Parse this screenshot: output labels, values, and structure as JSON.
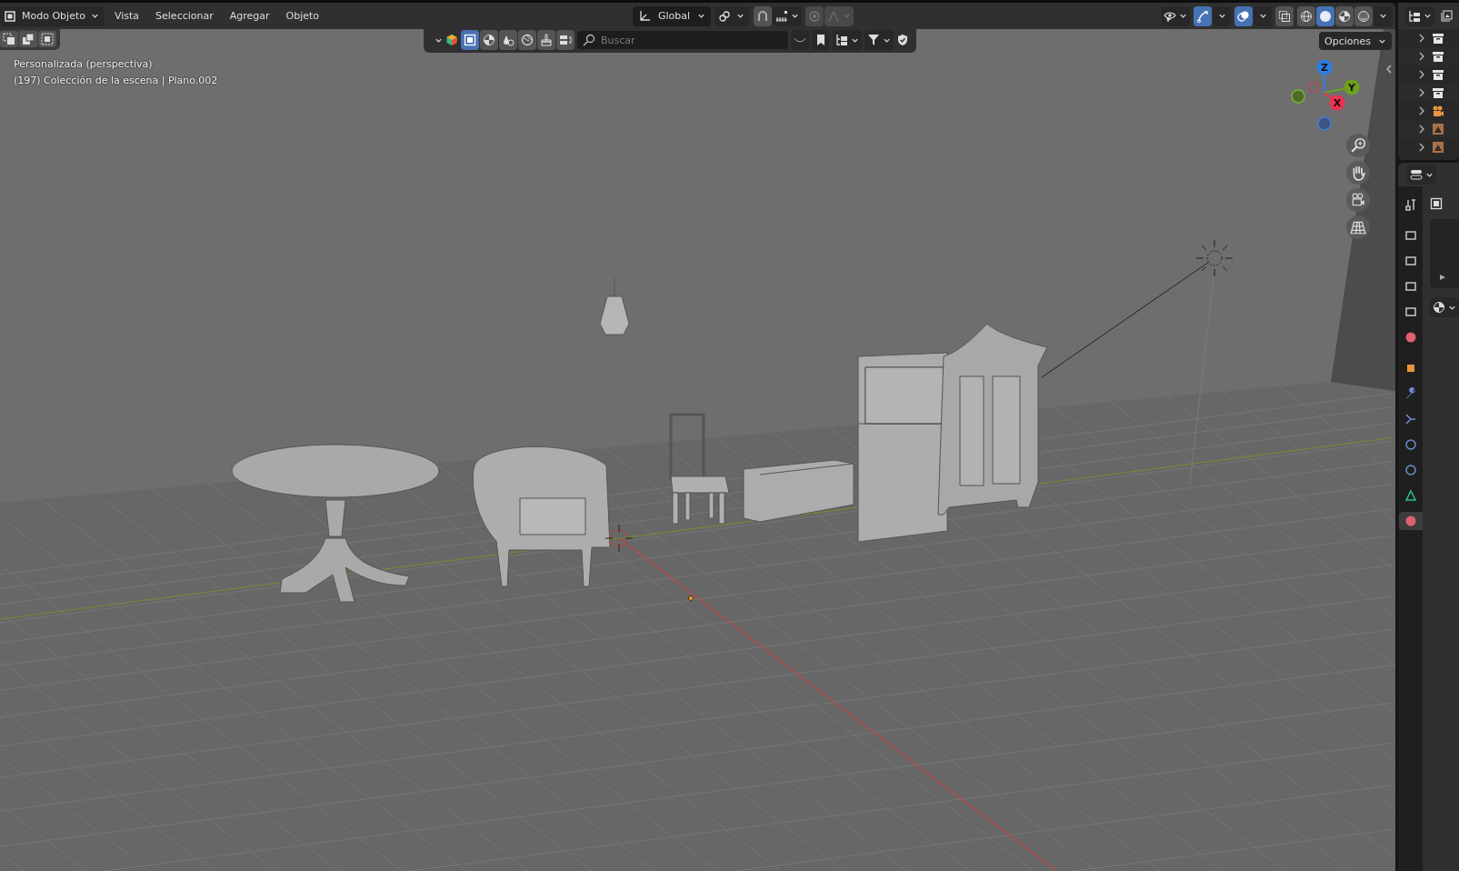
{
  "header": {
    "mode": "Modo Objeto",
    "menus": [
      "Vista",
      "Seleccionar",
      "Agregar",
      "Objeto"
    ],
    "orientation": "Global",
    "snap_on": false,
    "proportional_on": false,
    "gizmos_on": true,
    "overlays_on": true,
    "xray_on": false,
    "shading_modes": [
      {
        "kind": "wireframe",
        "selected": false
      },
      {
        "kind": "solid",
        "selected": true
      },
      {
        "kind": "material",
        "selected": false
      },
      {
        "kind": "rendered",
        "selected": false
      }
    ]
  },
  "viewport": {
    "view_name": "Personalizada (perspectiva)",
    "collection": "(197) Colección de la escena | Plano.002",
    "search_placeholder": "Buscar",
    "options": "Opciones",
    "filter_buttons": [
      {
        "kind": "object",
        "selected": true
      },
      {
        "kind": "shading",
        "selected": false
      },
      {
        "kind": "scene",
        "selected": false
      },
      {
        "kind": "world",
        "selected": false
      },
      {
        "kind": "brush",
        "selected": false
      },
      {
        "kind": "layout",
        "selected": false
      }
    ],
    "axes": [
      {
        "label": "Z",
        "color": "#2f7de1"
      },
      {
        "label": "Y",
        "color": "#6ea11c"
      },
      {
        "label": "X",
        "color": "#ee3150"
      }
    ]
  },
  "outliner": {
    "rows": [
      {
        "kind": "collection",
        "expanded": false
      },
      {
        "kind": "collection",
        "expanded": false
      },
      {
        "kind": "collection",
        "expanded": false
      },
      {
        "kind": "collection",
        "expanded": false
      },
      {
        "kind": "camera",
        "expanded": false
      },
      {
        "kind": "image",
        "expanded": false
      },
      {
        "kind": "image",
        "expanded": false
      }
    ]
  },
  "properties": {
    "tabs": [
      {
        "kind": "tool",
        "selected": false
      },
      {
        "kind": "render",
        "selected": false
      },
      {
        "kind": "output",
        "selected": false
      },
      {
        "kind": "view_layer",
        "selected": false
      },
      {
        "kind": "scene",
        "selected": false
      },
      {
        "kind": "world",
        "selected": false
      },
      {
        "kind": "object",
        "selected": false
      },
      {
        "kind": "modifiers",
        "selected": false
      },
      {
        "kind": "particles",
        "selected": false
      },
      {
        "kind": "physics",
        "selected": false
      },
      {
        "kind": "constraints",
        "selected": false
      },
      {
        "kind": "data",
        "selected": false
      },
      {
        "kind": "material",
        "selected": true
      }
    ]
  }
}
